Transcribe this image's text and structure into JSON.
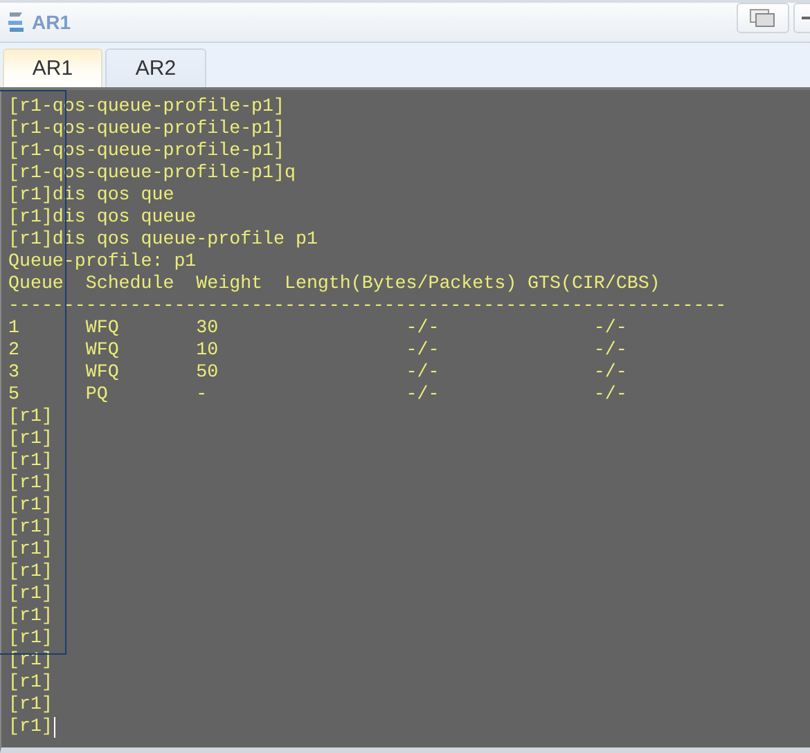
{
  "window": {
    "title": "AR1"
  },
  "tabs": [
    {
      "label": "AR1",
      "selected": true
    },
    {
      "label": "AR2",
      "selected": false
    }
  ],
  "terminal": {
    "lines": [
      "[r1-qos-queue-profile-p1]",
      "[r1-qos-queue-profile-p1]",
      "[r1-qos-queue-profile-p1]",
      "[r1-qos-queue-profile-p1]q",
      "[r1]dis qos que",
      "[r1]dis qos queue",
      "[r1]dis qos queue-profile p1",
      "Queue-profile: p1",
      "Queue  Schedule  Weight  Length(Bytes/Packets) GTS(CIR/CBS)",
      "-----------------------------------------------------------------",
      "1      WFQ       30                 -/-              -/-",
      "2      WFQ       10                 -/-              -/-",
      "3      WFQ       50                 -/-              -/-",
      "5      PQ        -                  -/-              -/-",
      "[r1]",
      "[r1]",
      "[r1]",
      "[r1]",
      "[r1]",
      "[r1]",
      "[r1]",
      "[r1]",
      "[r1]",
      "[r1]",
      "[r1]",
      "[r1]",
      "[r1]",
      "[r1]",
      "[r1]"
    ],
    "cursor": true
  }
}
